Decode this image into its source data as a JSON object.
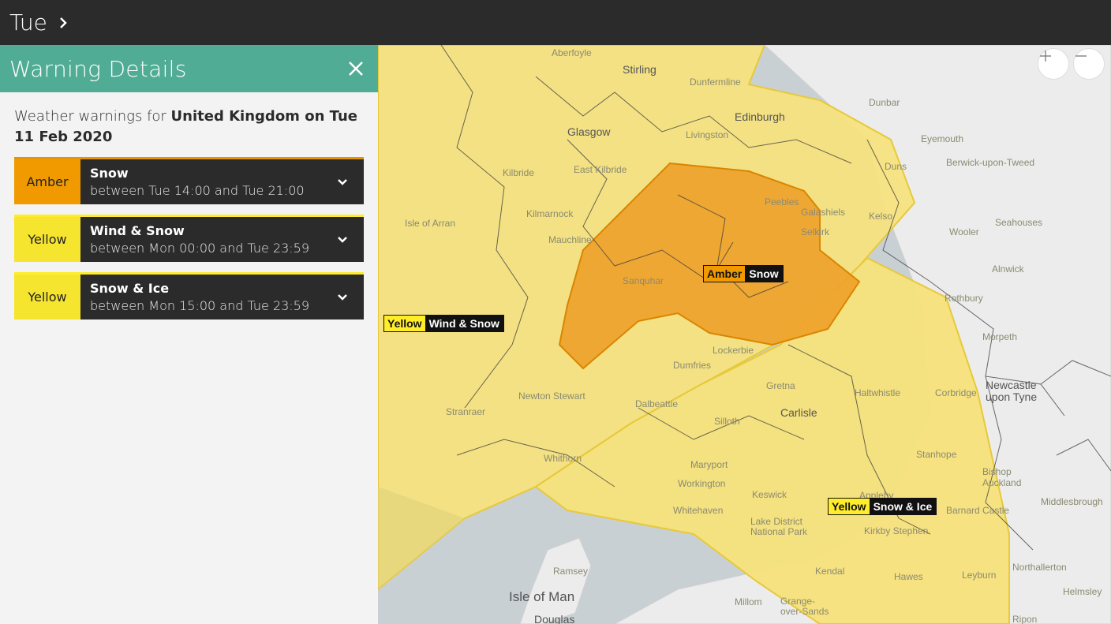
{
  "topbar": {
    "day": "Tue"
  },
  "panel": {
    "title": "Warning Details",
    "intro_prefix": "Weather warnings for ",
    "intro_bold": "United Kingdom on Tue 11 Feb 2020"
  },
  "warnings": [
    {
      "level": "Amber",
      "type": "Snow",
      "time": "between Tue 14:00 and Tue 21:00"
    },
    {
      "level": "Yellow",
      "type": "Wind & Snow",
      "time": "between Mon 00:00 and Tue 23:59"
    },
    {
      "level": "Yellow",
      "type": "Snow & Ice",
      "time": "between Mon 15:00 and Tue 23:59"
    }
  ],
  "map": {
    "tags": {
      "amber_snow": {
        "level": "Amber",
        "type": "Snow"
      },
      "yellow_wind_snow": {
        "level": "Yellow",
        "type": "Wind & Snow"
      },
      "yellow_snow_ice": {
        "level": "Yellow",
        "type": "Snow & Ice"
      }
    },
    "places": {
      "aberfoyle": "Aberfoyle",
      "stirling": "Stirling",
      "dunfermline": "Dunfermline",
      "edinburgh": "Edinburgh",
      "livingston": "Livingston",
      "glasgow": "Glasgow",
      "east_kilbride": "East Kilbride",
      "kilbride": "Kilbride",
      "kilmarnock": "Kilmarnock",
      "isle_of_arran": "Isle of Arran",
      "mauchline": "Mauchline",
      "sanquhar": "Sanquhar",
      "peebles": "Peebles",
      "galashiels": "Galashiels",
      "selkirk": "Selkirk",
      "kelso": "Kelso",
      "duns": "Duns",
      "eyemouth": "Eyemouth",
      "berwick": "Berwick-upon-Tweed",
      "dunbar": "Dunbar",
      "wooler": "Wooler",
      "seahouses": "Seahouses",
      "alnwick": "Alnwick",
      "rothbury": "Rothbury",
      "morpeth": "Morpeth",
      "newcastle": "Newcastle upon Tyne",
      "corbridge": "Corbridge",
      "haltwhistle": "Haltwhistle",
      "lockerbie": "Lockerbie",
      "dumfries": "Dumfries",
      "gretna": "Gretna",
      "carlisle": "Carlisle",
      "newton_stewart": "Newton Stewart",
      "stranraer": "Stranraer",
      "dalbeattie": "Dalbeattie",
      "silloth": "Silloth",
      "whithorn": "Whithorn",
      "maryport": "Maryport",
      "workington": "Workington",
      "whitehaven": "Whitehaven",
      "keswick": "Keswick",
      "lake_district": "Lake District National Park",
      "appleby": "Appleby",
      "stanhope": "Stanhope",
      "bishop_auckland": "Bishop Auckland",
      "barnard_castle": "Barnard Castle",
      "middlesbrough": "Middlesbrough",
      "northallerton": "Northallerton",
      "kirkby_stephen": "Kirkby Stephen",
      "kendal": "Kendal",
      "hawes": "Hawes",
      "leyburn": "Leyburn",
      "ramsey": "Ramsey",
      "isle_of_man": "Isle of Man",
      "douglas": "Douglas",
      "millom": "Millom",
      "grange": "Grange-over-Sands",
      "helmsley": "Helmsley",
      "ripon": "Ripon"
    },
    "colors": {
      "sea": "#c8d0d4",
      "land": "#ececec",
      "yellow": "#f7e27a",
      "amber": "#eea12a"
    }
  }
}
